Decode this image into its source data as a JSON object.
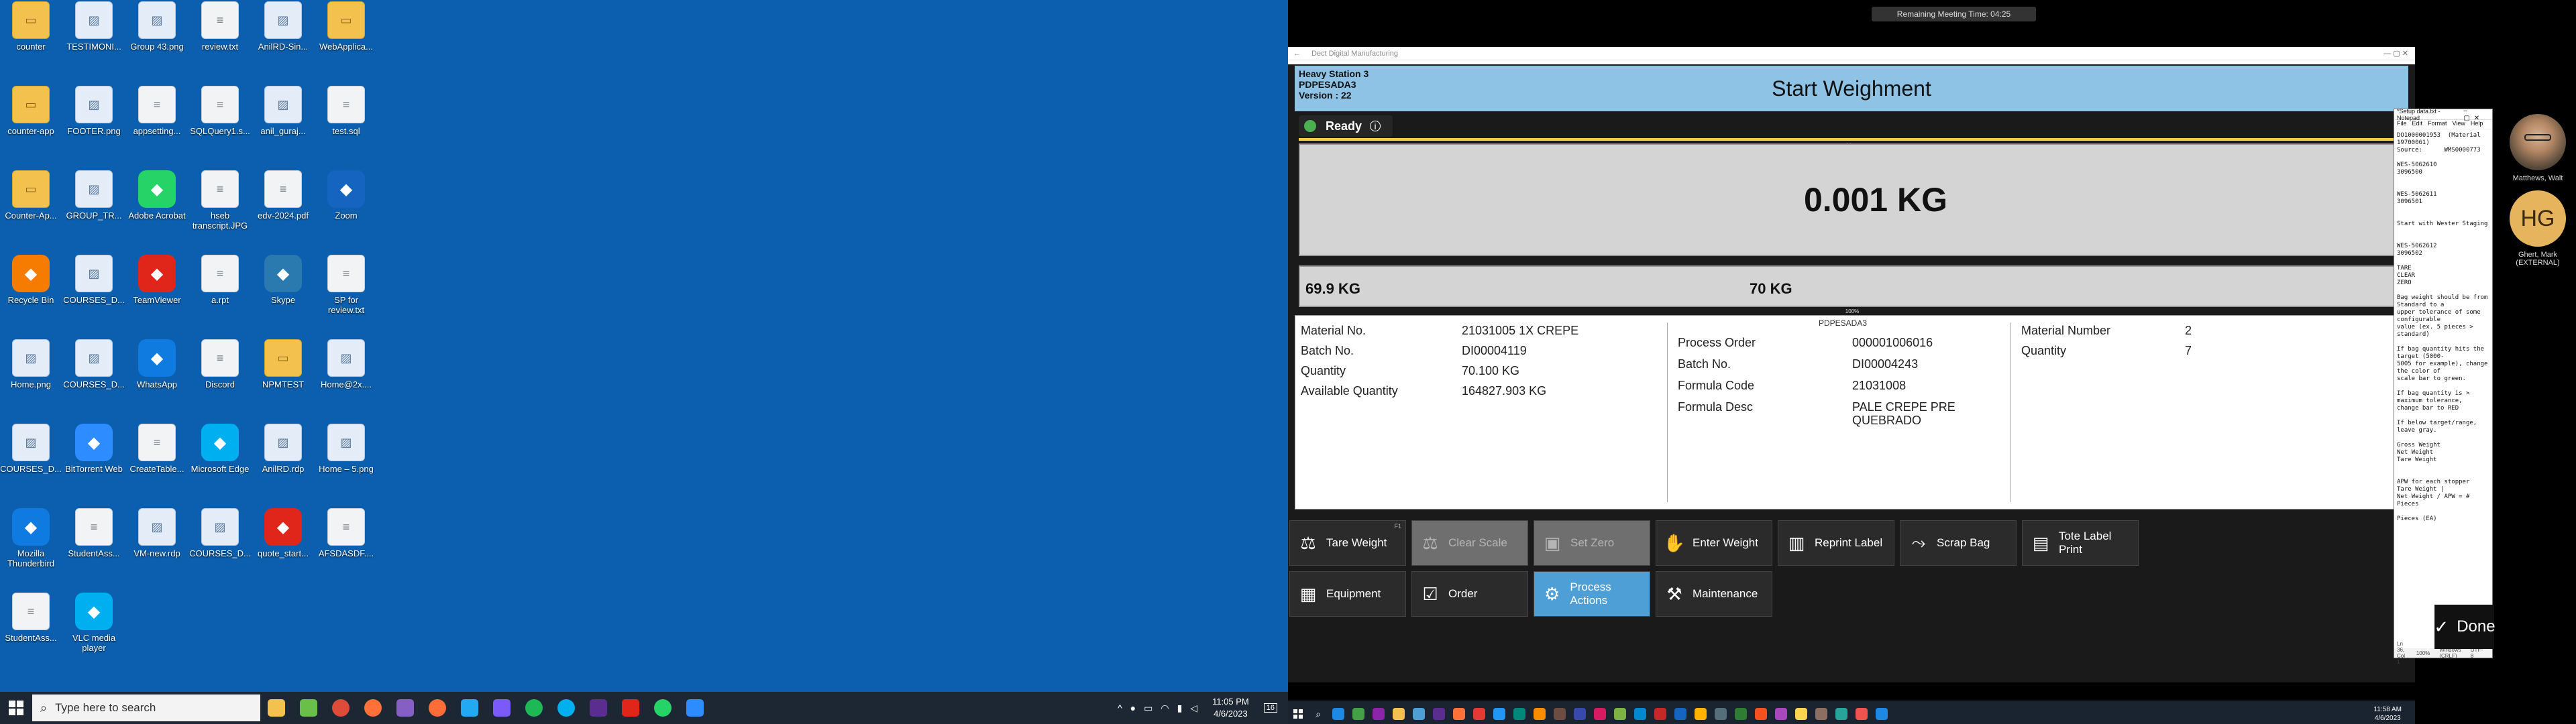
{
  "desktop": {
    "icons": [
      {
        "label": "counter",
        "type": "folder"
      },
      {
        "label": "TESTIMONI...",
        "type": "img"
      },
      {
        "label": "Group 43.png",
        "type": "img"
      },
      {
        "label": "review.txt",
        "type": "file"
      },
      {
        "label": "AnilRD-Sin...",
        "type": "img"
      },
      {
        "label": "WebApplica...",
        "type": "folder"
      },
      {
        "label": "counter-app",
        "type": "folder"
      },
      {
        "label": "FOOTER.png",
        "type": "img"
      },
      {
        "label": "appsetting...",
        "type": "file"
      },
      {
        "label": "SQLQuery1.s...",
        "type": "file"
      },
      {
        "label": "anil_guraj...",
        "type": "img"
      },
      {
        "label": "test.sql",
        "type": "file"
      },
      {
        "label": "Counter-Ap...",
        "type": "folder"
      },
      {
        "label": "GROUP_TR...",
        "type": "img"
      },
      {
        "label": "Adobe Acrobat",
        "type": "app"
      },
      {
        "label": "hseb transcript.JPG",
        "type": "file"
      },
      {
        "label": "edv-2024.pdf",
        "type": "file"
      },
      {
        "label": "Zoom",
        "type": "app"
      },
      {
        "label": "Recycle Bin",
        "type": "app"
      },
      {
        "label": "COURSES_D...",
        "type": "img"
      },
      {
        "label": "TeamViewer",
        "type": "app"
      },
      {
        "label": "a.rpt",
        "type": "file"
      },
      {
        "label": "Skype",
        "type": "app"
      },
      {
        "label": "SP for review.txt",
        "type": "file"
      },
      {
        "label": "Home.png",
        "type": "img"
      },
      {
        "label": "COURSES_D...",
        "type": "img"
      },
      {
        "label": "WhatsApp",
        "type": "app"
      },
      {
        "label": "Discord",
        "type": "file"
      },
      {
        "label": "NPMTEST",
        "type": "folder"
      },
      {
        "label": "Home@2x....",
        "type": "img"
      },
      {
        "label": "COURSES_D...",
        "type": "img"
      },
      {
        "label": "BitTorrent Web",
        "type": "app"
      },
      {
        "label": "CreateTable...",
        "type": "file"
      },
      {
        "label": "Microsoft Edge",
        "type": "app"
      },
      {
        "label": "AnilRD.rdp",
        "type": "img"
      },
      {
        "label": "Home – 5.png",
        "type": "img"
      },
      {
        "label": "Mozilla Thunderbird",
        "type": "app"
      },
      {
        "label": "StudentAss...",
        "type": "file"
      },
      {
        "label": "VM-new.rdp",
        "type": "img"
      },
      {
        "label": "COURSES_D...",
        "type": "img"
      },
      {
        "label": "quote_start...",
        "type": "app"
      },
      {
        "label": "AFSDASDF....",
        "type": "file"
      },
      {
        "label": "StudentAss...",
        "type": "file"
      },
      {
        "label": "VLC media player",
        "type": "app"
      }
    ],
    "taskbar": {
      "search_placeholder": "Type here to search",
      "time": "11:05 PM",
      "date": "4/6/2023",
      "notification_count": "16"
    }
  },
  "meeting": {
    "remaining_time": "Remaining Meeting Time: 04:25",
    "participants": [
      {
        "name": "Matthews, Walt"
      },
      {
        "initials": "HG",
        "name": "Ghert, Mark (EXTERNAL)"
      }
    ]
  },
  "app": {
    "window_title": "Dect Digital Manufacturing",
    "station_name": "Heavy Station 3",
    "station_id": "PDPESADA3",
    "version": "Version : 22",
    "title": "Start Weighment",
    "status": "Ready",
    "weight": "0.001 KG",
    "gross_weight": "69.9 KG",
    "target_weight": "70 KG",
    "percent_label": "100%",
    "panel_station": "PDPESADA3",
    "left": {
      "material_no_label": "Material No.",
      "material_no": "21031005 1X CREPE",
      "batch_no_label": "Batch No.",
      "batch_no": "DI00004119",
      "quantity_label": "Quantity",
      "quantity": "70.100 KG",
      "available_quantity_label": "Available Quantity",
      "available_quantity": "164827.903 KG"
    },
    "middle": {
      "process_order_label": "Process Order",
      "process_order": "000001006016",
      "batch_no_label": "Batch No.",
      "batch_no": "DI00004243",
      "formula_code_label": "Formula Code",
      "formula_code": "21031008",
      "formula_desc_label": "Formula Desc",
      "formula_desc": "PALE CREPE PRE QUEBRADO"
    },
    "right": {
      "material_number_label": "Material Number",
      "material_number": "2",
      "quantity_label": "Quantity",
      "quantity": "7"
    },
    "buttons_row1": [
      {
        "label": "Tare Weight",
        "state": "normal"
      },
      {
        "label": "Clear Scale",
        "state": "disabled"
      },
      {
        "label": "Set Zero",
        "state": "disabled"
      },
      {
        "label": "Enter Weight",
        "state": "normal"
      },
      {
        "label": "Reprint Label",
        "state": "normal"
      },
      {
        "label": "Scrap Bag",
        "state": "normal"
      },
      {
        "label": "Tote Label Print",
        "state": "normal"
      }
    ],
    "buttons_row2": [
      {
        "label": "Equipment",
        "state": "normal"
      },
      {
        "label": "Order",
        "state": "normal"
      },
      {
        "label": "Process Actions",
        "state": "active"
      },
      {
        "label": "Maintenance",
        "state": "normal"
      }
    ],
    "done_label": "Done"
  },
  "notepad": {
    "title": "*Setup data.txt - Notepad",
    "menu": [
      "File",
      "Edit",
      "Format",
      "View",
      "Help"
    ],
    "text": "DO1000001953  (Material 19700061)\nSource:      WMS0000773\n\nWES-5062610\n3096500\n\n\nWES-5062611\n3096501\n\n\nStart with Wester Staging\n\n\nWES-5062612\n3096502\n\nTARE\nCLEAR\nZERO\n\nBag weight should be from Standard to a\nupper tolerance of some configurable\nvalue (ex. 5 pieces > standard)\n\nIf bag quantity hits the target (5000-\n5005 for example), change the color of\nscale bar to green.\n\nIf bag quantity is > maximum tolerance,\nchange bar to RED\n\nIf below target/range, leave gray.\n\nGross Weight\nNet Weight\nTare Weight\n\n\nAPW for each stopper\nTare Weight |\nNet Weight / APW = # Pieces\n\nPieces (EA)",
    "status_pos": "Ln 36, Col 1",
    "status_zoom": "100%",
    "status_eol": "Windows (CRLF)",
    "status_enc": "UTF-8"
  },
  "remote_taskbar": {
    "time": "11:58 AM",
    "date": "4/6/2023"
  }
}
